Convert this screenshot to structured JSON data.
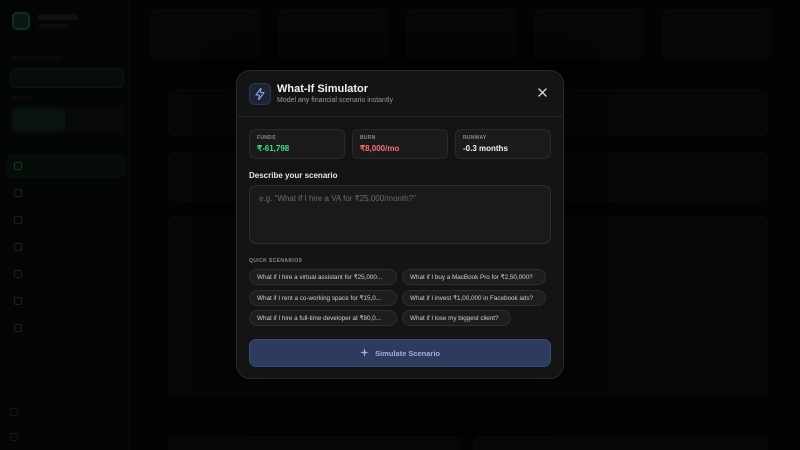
{
  "modal": {
    "title": "What-If Simulator",
    "subtitle": "Model any financial scenario instantly",
    "metrics": [
      {
        "label": "FUNDS",
        "value": "₹-61,798",
        "color": "#4ade80"
      },
      {
        "label": "BURN",
        "value": "₹8,000/mo",
        "color": "#f87171"
      },
      {
        "label": "RUNWAY",
        "value": "-0.3 months",
        "color": "#f2f2f2"
      }
    ],
    "describe_label": "Describe your scenario",
    "input_placeholder": "e.g. \"What if I hire a VA for ₹25,000/month?\"",
    "input_value": "",
    "quick_label": "QUICK SCENARIOS",
    "scenarios": [
      "What if I hire a virtual assistant for ₹25,000...",
      "What if I buy a MacBook Pro for ₹2,50,000?",
      "What if I rent a co-working space for ₹15,0...",
      "What if I invest ₹1,00,000 in Facebook ads?",
      "What if I hire a full-time developer at ₹80,0...",
      "What if I lose my biggest client?"
    ],
    "simulate_label": "Simulate Scenario",
    "icons": {
      "header": "lightning-icon",
      "close": "close-icon",
      "button": "sparkle-icon"
    }
  },
  "colors": {
    "accent": "#2d3b5d",
    "positive": "#4ade80",
    "negative": "#f87171"
  }
}
